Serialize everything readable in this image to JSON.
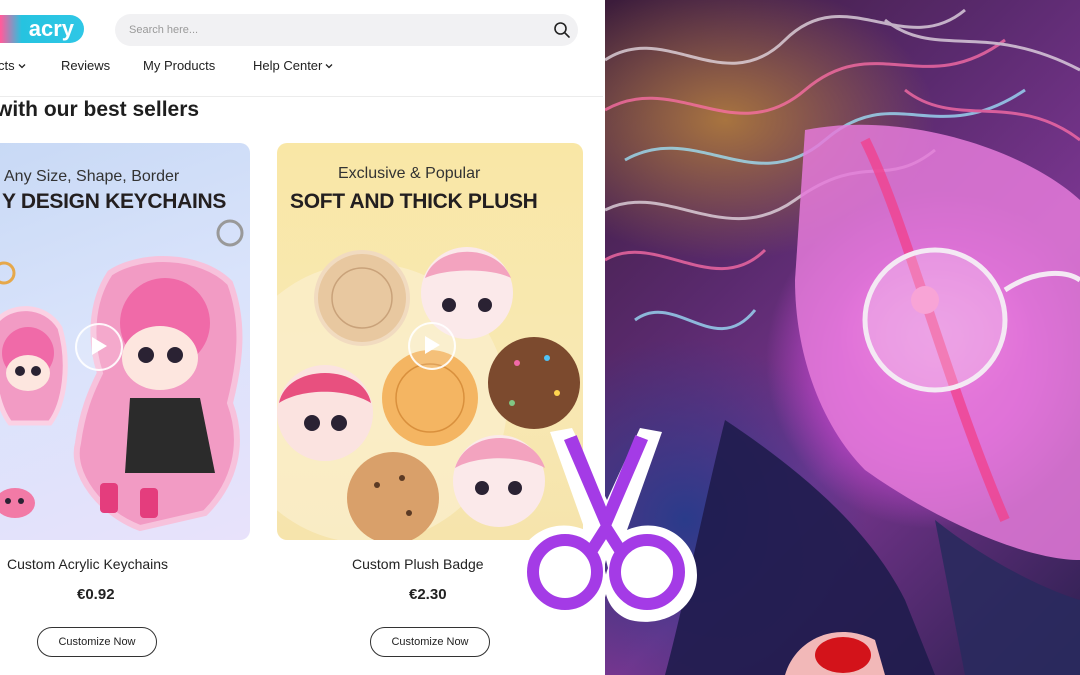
{
  "brand": {
    "logo_text": "acry"
  },
  "search": {
    "placeholder": "Search here..."
  },
  "nav": {
    "items": [
      {
        "label": "cts"
      },
      {
        "label": "Reviews"
      },
      {
        "label": "My Products"
      },
      {
        "label": "Help Center"
      }
    ]
  },
  "section": {
    "title": "with our best sellers"
  },
  "products": [
    {
      "banner_sub": "Any Size, Shape, Border",
      "banner_head": "Y DESIGN KEYCHAINS",
      "name": "Custom Acrylic Keychains",
      "price": "€0.92",
      "button": "Customize Now"
    },
    {
      "banner_sub": "Exclusive & Popular",
      "banner_head": "SOFT AND THICK PLUSH",
      "name": "Custom Plush Badge",
      "price": "€2.30",
      "button": "Customize Now"
    }
  ],
  "colors": {
    "scissors": "#a43be6",
    "logo_pink": "#ff3b7a",
    "logo_cyan": "#26c3e0"
  }
}
